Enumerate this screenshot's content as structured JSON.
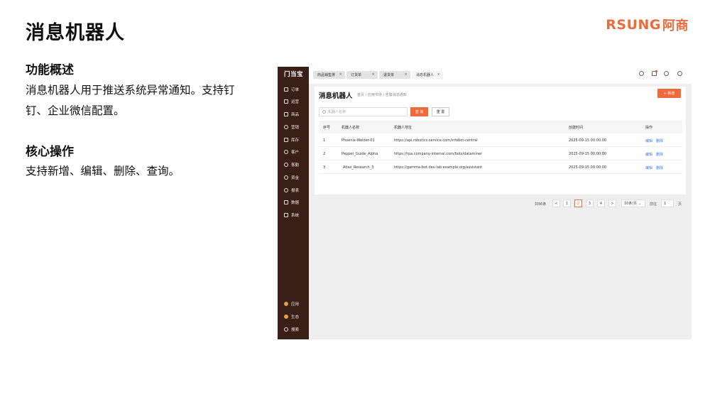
{
  "slide": {
    "title": "消息机器人",
    "brand_latin": "RSUNG",
    "brand_cn": "阿商",
    "section1_title": "功能概述",
    "section1_body": "消息机器人用于推送系统异常通知。支持钉钉、企业微信配置。",
    "section2_title": "核心操作",
    "section2_body": "支持新增、编辑、删除、查询。"
  },
  "app": {
    "logo": "门当宝",
    "nav": [
      {
        "label": "订单",
        "icon": "order-icon"
      },
      {
        "label": "运营",
        "icon": "operation-icon"
      },
      {
        "label": "商品",
        "icon": "product-icon"
      },
      {
        "label": "营销",
        "icon": "marketing-icon"
      },
      {
        "label": "库存",
        "icon": "inventory-icon"
      },
      {
        "label": "客户",
        "icon": "customer-icon"
      },
      {
        "label": "客勤",
        "icon": "service-icon"
      },
      {
        "label": "资金",
        "icon": "funds-icon"
      },
      {
        "label": "报表",
        "icon": "report-icon"
      },
      {
        "label": "数据",
        "icon": "data-icon"
      },
      {
        "label": "系统",
        "icon": "system-icon"
      }
    ],
    "nav_bottom": [
      {
        "label": "应用",
        "icon": "apps-icon"
      },
      {
        "label": "生态",
        "icon": "ecosystem-icon"
      },
      {
        "label": "搜索",
        "icon": "search-icon"
      }
    ],
    "tabs": [
      {
        "label": "商品销售排"
      },
      {
        "label": "订货单"
      },
      {
        "label": "退货单"
      },
      {
        "label": "消息机器人"
      }
    ],
    "page_title": "消息机器人",
    "breadcrumb": "首页 / 应用市场 / 告警消息通知",
    "new_button": "+ 新增",
    "search_placeholder": "机器人名称",
    "query_button": "查 询",
    "reset_button": "重 置",
    "table": {
      "columns": [
        "序号",
        "机器人名称",
        "机器人地址",
        "创建时间",
        "操作"
      ],
      "rows": [
        {
          "no": "1",
          "name": "Phoenix-Welder-01",
          "url": "https://api.robotics-service.com/infobot-central",
          "time": "2025-09-15 00:00:00",
          "edit": "编辑",
          "del": "删除"
        },
        {
          "no": "2",
          "name": "Pepper_Guide_Alpha",
          "url": "https://rpa.company-internal.com/bots/dataminer",
          "time": "2025-09-15 00:00:00",
          "edit": "编辑",
          "del": "删除"
        },
        {
          "no": "3",
          "name": "Atlas_Research_3",
          "url": "https://gamma-bot.dev-lab.example.org/assistant",
          "time": "2025-09-15 00:00:00",
          "edit": "编辑",
          "del": "删除"
        }
      ]
    },
    "pager": {
      "total": "共86条",
      "prev": "<",
      "pages": [
        "1",
        "2",
        "3",
        "4"
      ],
      "current": "2",
      "next": ">",
      "page_size": "10条/页",
      "goto_label": "前往",
      "goto_value": "1",
      "page_unit": "页"
    },
    "colors": {
      "accent": "#ee6a3b",
      "sidebar": "#3a1f17",
      "link": "#3d7be8"
    }
  }
}
